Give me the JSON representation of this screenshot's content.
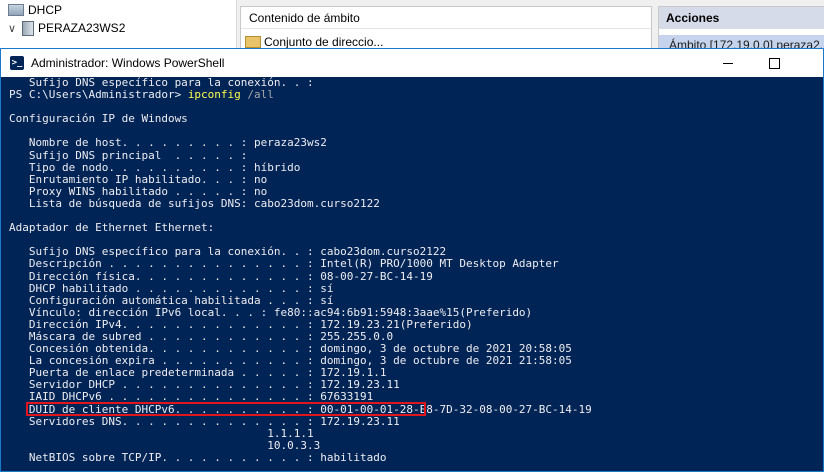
{
  "mmc": {
    "tree": {
      "root_label": "DHCP",
      "server_label": "PERAZA23WS2"
    },
    "middle": {
      "header": "Contenido de ámbito",
      "item": "Conjunto de direccio..."
    },
    "actions": {
      "header": "Acciones",
      "item": "Ámbito [172.19.0.0] peraza2..."
    }
  },
  "powershell": {
    "title": "Administrador: Windows PowerShell",
    "prompt": "PS C:\\Users\\Administrador> ",
    "command": "ipconfig",
    "parameter": " /all",
    "lines_before_prompt": [
      "   Sufijo DNS específico para la conexión. . :"
    ],
    "lines_after_prompt": [
      "",
      "Configuración IP de Windows",
      "",
      "   Nombre de host. . . . . . . . . : peraza23ws2",
      "   Sufijo DNS principal  . . . . . :",
      "   Tipo de nodo. . . . . . . . . . : híbrido",
      "   Enrutamiento IP habilitado. . . : no",
      "   Proxy WINS habilitado . . . . . : no",
      "   Lista de búsqueda de sufijos DNS: cabo23dom.curso2122",
      "",
      "Adaptador de Ethernet Ethernet:",
      "",
      "   Sufijo DNS específico para la conexión. . : cabo23dom.curso2122",
      "   Descripción . . . . . . . . . . . . . . . : Intel(R) PRO/1000 MT Desktop Adapter",
      "   Dirección física. . . . . . . . . . . . . : 08-00-27-BC-14-19",
      "   DHCP habilitado . . . . . . . . . . . . . : sí",
      "   Configuración automática habilitada . . . : sí",
      "   Vínculo: dirección IPv6 local. . . : fe80::ac94:6b91:5948:3aae%15(Preferido)",
      "   Dirección IPv4. . . . . . . . . . . . . . : 172.19.23.21(Preferido)",
      "   Máscara de subred . . . . . . . . . . . . : 255.255.0.0",
      "   Concesión obtenida. . . . . . . . . . . . : domingo, 3 de octubre de 2021 20:58:05",
      "   La concesión expira . . . . . . . . . . . : domingo, 3 de octubre de 2021 21:58:05",
      "   Puerta de enlace predeterminada . . . . . : 172.19.1.1",
      "   Servidor DHCP . . . . . . . . . . . . . . : 172.19.23.11",
      "   IAID DHCPv6 . . . . . . . . . . . . . . . : 67633191",
      "   DUID de cliente DHCPv6. . . . . . . . . . : 00-01-00-01-28-E8-7D-32-08-00-27-BC-14-19",
      "   Servidores DNS. . . . . . . . . . . . . . : 172.19.23.11",
      "                                       1.1.1.1",
      "                                       10.0.3.3",
      "   NetBIOS sobre TCP/IP. . . . . . . . . . . : habilitado"
    ],
    "highlighted_line": "   Servidor DHCP . . . . . . . . . . . . . . : 172.19.23.11"
  },
  "colors": {
    "console_background": "#012456",
    "console_text": "#eeedf0",
    "command_text": "#fefd4a",
    "highlight_border": "#e0161c",
    "actions_header": "#d6dbe9",
    "actions_selected": "#c5d4ec"
  },
  "icons": {
    "tree_expand": "chevron-down-icon",
    "dhcp": "dhcp-icon",
    "server": "server-icon",
    "folder": "folder-icon",
    "powershell": "powershell-icon"
  }
}
